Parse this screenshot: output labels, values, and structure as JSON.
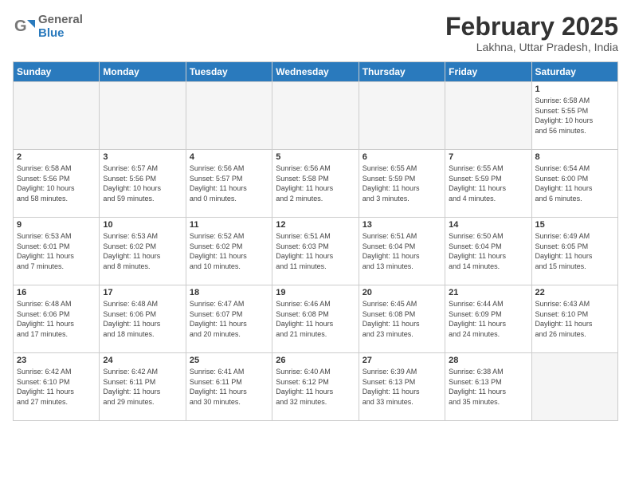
{
  "header": {
    "logo_general": "General",
    "logo_blue": "Blue",
    "month_title": "February 2025",
    "location": "Lakhna, Uttar Pradesh, India"
  },
  "days_of_week": [
    "Sunday",
    "Monday",
    "Tuesday",
    "Wednesday",
    "Thursday",
    "Friday",
    "Saturday"
  ],
  "weeks": [
    [
      {
        "day": "",
        "info": "",
        "empty": true
      },
      {
        "day": "",
        "info": "",
        "empty": true
      },
      {
        "day": "",
        "info": "",
        "empty": true
      },
      {
        "day": "",
        "info": "",
        "empty": true
      },
      {
        "day": "",
        "info": "",
        "empty": true
      },
      {
        "day": "",
        "info": "",
        "empty": true
      },
      {
        "day": "1",
        "info": "Sunrise: 6:58 AM\nSunset: 5:55 PM\nDaylight: 10 hours\nand 56 minutes."
      }
    ],
    [
      {
        "day": "2",
        "info": "Sunrise: 6:58 AM\nSunset: 5:56 PM\nDaylight: 10 hours\nand 58 minutes."
      },
      {
        "day": "3",
        "info": "Sunrise: 6:57 AM\nSunset: 5:56 PM\nDaylight: 10 hours\nand 59 minutes."
      },
      {
        "day": "4",
        "info": "Sunrise: 6:56 AM\nSunset: 5:57 PM\nDaylight: 11 hours\nand 0 minutes."
      },
      {
        "day": "5",
        "info": "Sunrise: 6:56 AM\nSunset: 5:58 PM\nDaylight: 11 hours\nand 2 minutes."
      },
      {
        "day": "6",
        "info": "Sunrise: 6:55 AM\nSunset: 5:59 PM\nDaylight: 11 hours\nand 3 minutes."
      },
      {
        "day": "7",
        "info": "Sunrise: 6:55 AM\nSunset: 5:59 PM\nDaylight: 11 hours\nand 4 minutes."
      },
      {
        "day": "8",
        "info": "Sunrise: 6:54 AM\nSunset: 6:00 PM\nDaylight: 11 hours\nand 6 minutes."
      }
    ],
    [
      {
        "day": "9",
        "info": "Sunrise: 6:53 AM\nSunset: 6:01 PM\nDaylight: 11 hours\nand 7 minutes."
      },
      {
        "day": "10",
        "info": "Sunrise: 6:53 AM\nSunset: 6:02 PM\nDaylight: 11 hours\nand 8 minutes."
      },
      {
        "day": "11",
        "info": "Sunrise: 6:52 AM\nSunset: 6:02 PM\nDaylight: 11 hours\nand 10 minutes."
      },
      {
        "day": "12",
        "info": "Sunrise: 6:51 AM\nSunset: 6:03 PM\nDaylight: 11 hours\nand 11 minutes."
      },
      {
        "day": "13",
        "info": "Sunrise: 6:51 AM\nSunset: 6:04 PM\nDaylight: 11 hours\nand 13 minutes."
      },
      {
        "day": "14",
        "info": "Sunrise: 6:50 AM\nSunset: 6:04 PM\nDaylight: 11 hours\nand 14 minutes."
      },
      {
        "day": "15",
        "info": "Sunrise: 6:49 AM\nSunset: 6:05 PM\nDaylight: 11 hours\nand 15 minutes."
      }
    ],
    [
      {
        "day": "16",
        "info": "Sunrise: 6:48 AM\nSunset: 6:06 PM\nDaylight: 11 hours\nand 17 minutes."
      },
      {
        "day": "17",
        "info": "Sunrise: 6:48 AM\nSunset: 6:06 PM\nDaylight: 11 hours\nand 18 minutes."
      },
      {
        "day": "18",
        "info": "Sunrise: 6:47 AM\nSunset: 6:07 PM\nDaylight: 11 hours\nand 20 minutes."
      },
      {
        "day": "19",
        "info": "Sunrise: 6:46 AM\nSunset: 6:08 PM\nDaylight: 11 hours\nand 21 minutes."
      },
      {
        "day": "20",
        "info": "Sunrise: 6:45 AM\nSunset: 6:08 PM\nDaylight: 11 hours\nand 23 minutes."
      },
      {
        "day": "21",
        "info": "Sunrise: 6:44 AM\nSunset: 6:09 PM\nDaylight: 11 hours\nand 24 minutes."
      },
      {
        "day": "22",
        "info": "Sunrise: 6:43 AM\nSunset: 6:10 PM\nDaylight: 11 hours\nand 26 minutes."
      }
    ],
    [
      {
        "day": "23",
        "info": "Sunrise: 6:42 AM\nSunset: 6:10 PM\nDaylight: 11 hours\nand 27 minutes."
      },
      {
        "day": "24",
        "info": "Sunrise: 6:42 AM\nSunset: 6:11 PM\nDaylight: 11 hours\nand 29 minutes."
      },
      {
        "day": "25",
        "info": "Sunrise: 6:41 AM\nSunset: 6:11 PM\nDaylight: 11 hours\nand 30 minutes."
      },
      {
        "day": "26",
        "info": "Sunrise: 6:40 AM\nSunset: 6:12 PM\nDaylight: 11 hours\nand 32 minutes."
      },
      {
        "day": "27",
        "info": "Sunrise: 6:39 AM\nSunset: 6:13 PM\nDaylight: 11 hours\nand 33 minutes."
      },
      {
        "day": "28",
        "info": "Sunrise: 6:38 AM\nSunset: 6:13 PM\nDaylight: 11 hours\nand 35 minutes."
      },
      {
        "day": "",
        "info": "",
        "empty": true
      }
    ]
  ]
}
